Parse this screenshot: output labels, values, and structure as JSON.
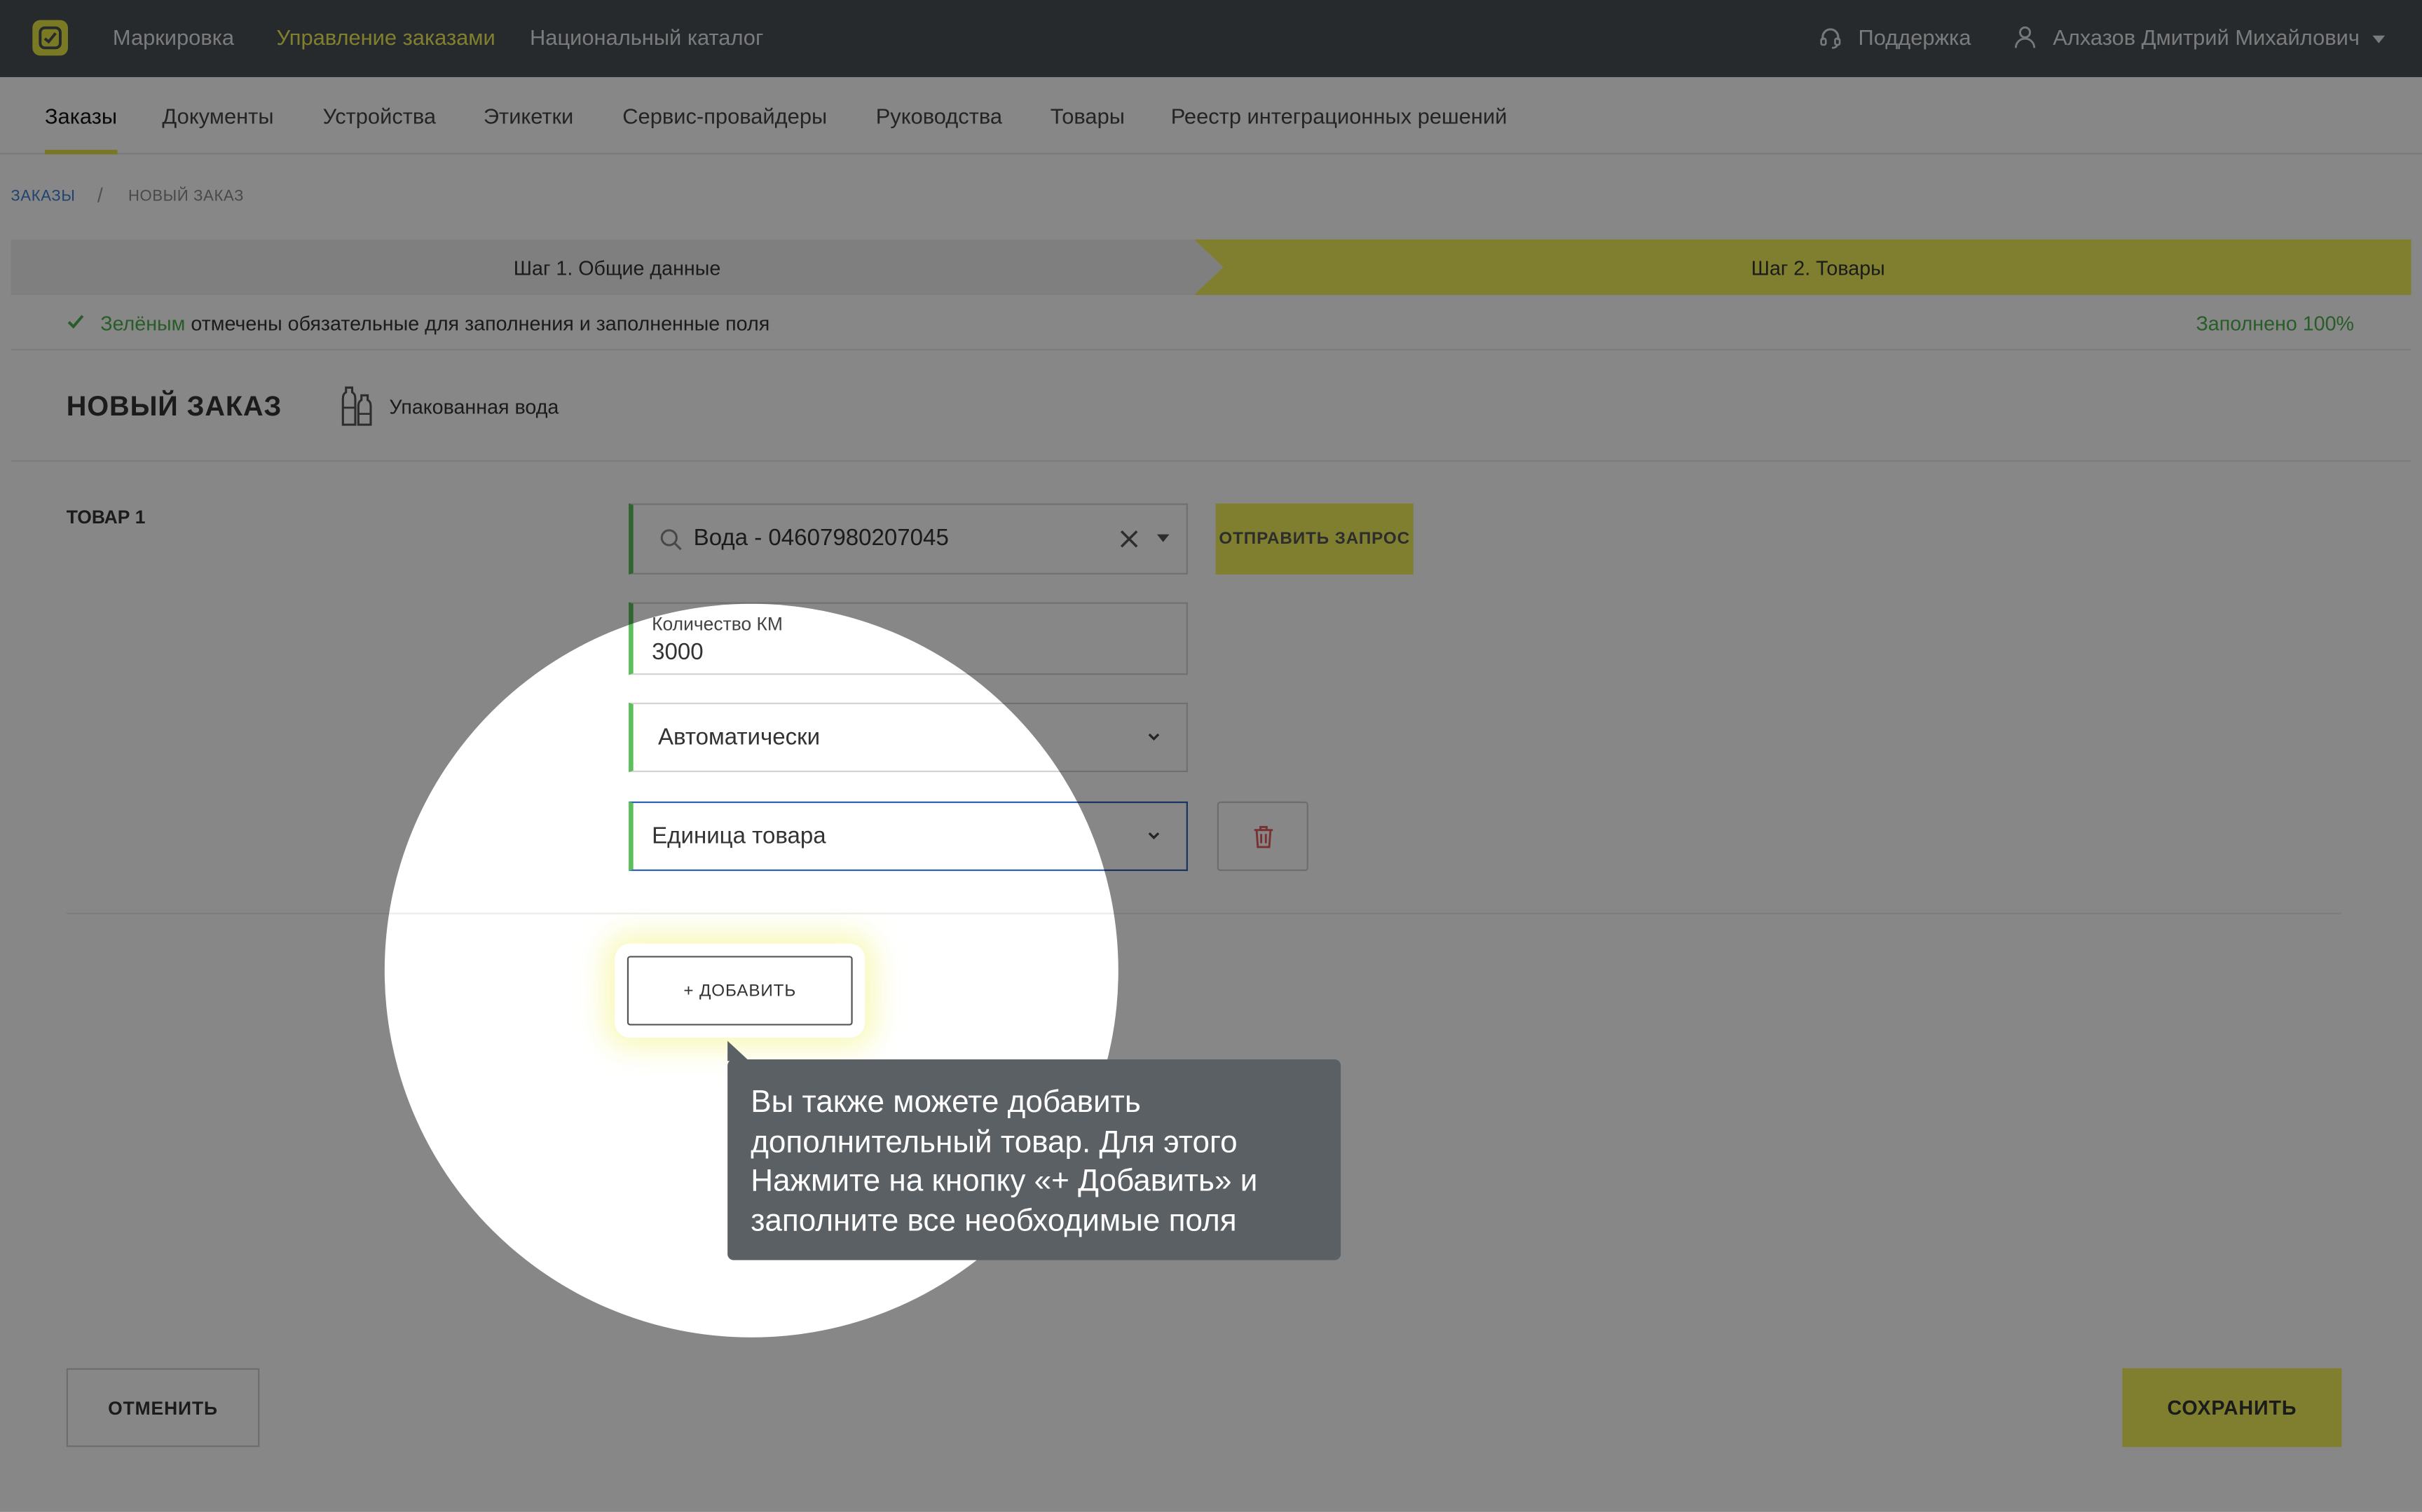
{
  "topnav": {
    "items": [
      "Маркировка",
      "Управление заказами",
      "Национальный каталог"
    ],
    "support": "Поддержка",
    "user": "Алхазов Дмитрий Михайлович"
  },
  "subnav": {
    "items": [
      "Заказы",
      "Документы",
      "Устройства",
      "Этикетки",
      "Сервис-провайдеры",
      "Руководства",
      "Товары",
      "Реестр интеграционных решений"
    ]
  },
  "breadcrumb": {
    "root": "ЗАКАЗЫ",
    "separator": "/",
    "current": "НОВЫЙ ЗАКАЗ"
  },
  "steps": {
    "step1": "Шаг 1. Общие данные",
    "step2": "Шаг 2. Товары"
  },
  "hint": {
    "highlight": "Зелёным",
    "text": " отмечены обязательные для заполнения и заполненные поля",
    "progress": "Заполнено 100%"
  },
  "order": {
    "title": "НОВЫЙ ЗАКАЗ",
    "category": "Упакованная вода",
    "item_label": "ТОВАР 1",
    "product_value": "Вода - 04607980207045",
    "send_request": "ОТПРАВИТЬ ЗАПРОС",
    "quantity_label": "Количество КМ",
    "quantity_value": "3000",
    "mode_value": "Автоматически",
    "unit_value": "Единица товара",
    "add_button": "+ ДОБАВИТЬ"
  },
  "actions": {
    "cancel": "ОТМЕНИТЬ",
    "save": "СОХРАНИТЬ"
  },
  "tooltip": {
    "text": "Вы также можете добавить дополнительный товар. Для этого Нажмите на кнопку «+ Добавить» и заполните все необходимые поля"
  },
  "colors": {
    "accent": "#f0f05a",
    "topbar": "#4a5055",
    "required_green": "#5cbf5c",
    "tooltip_bg": "#5b6065"
  },
  "icons": [
    "logo-icon",
    "headset-icon",
    "user-icon",
    "bottles-icon",
    "search-icon",
    "clear-icon",
    "trash-icon",
    "check-icon"
  ]
}
